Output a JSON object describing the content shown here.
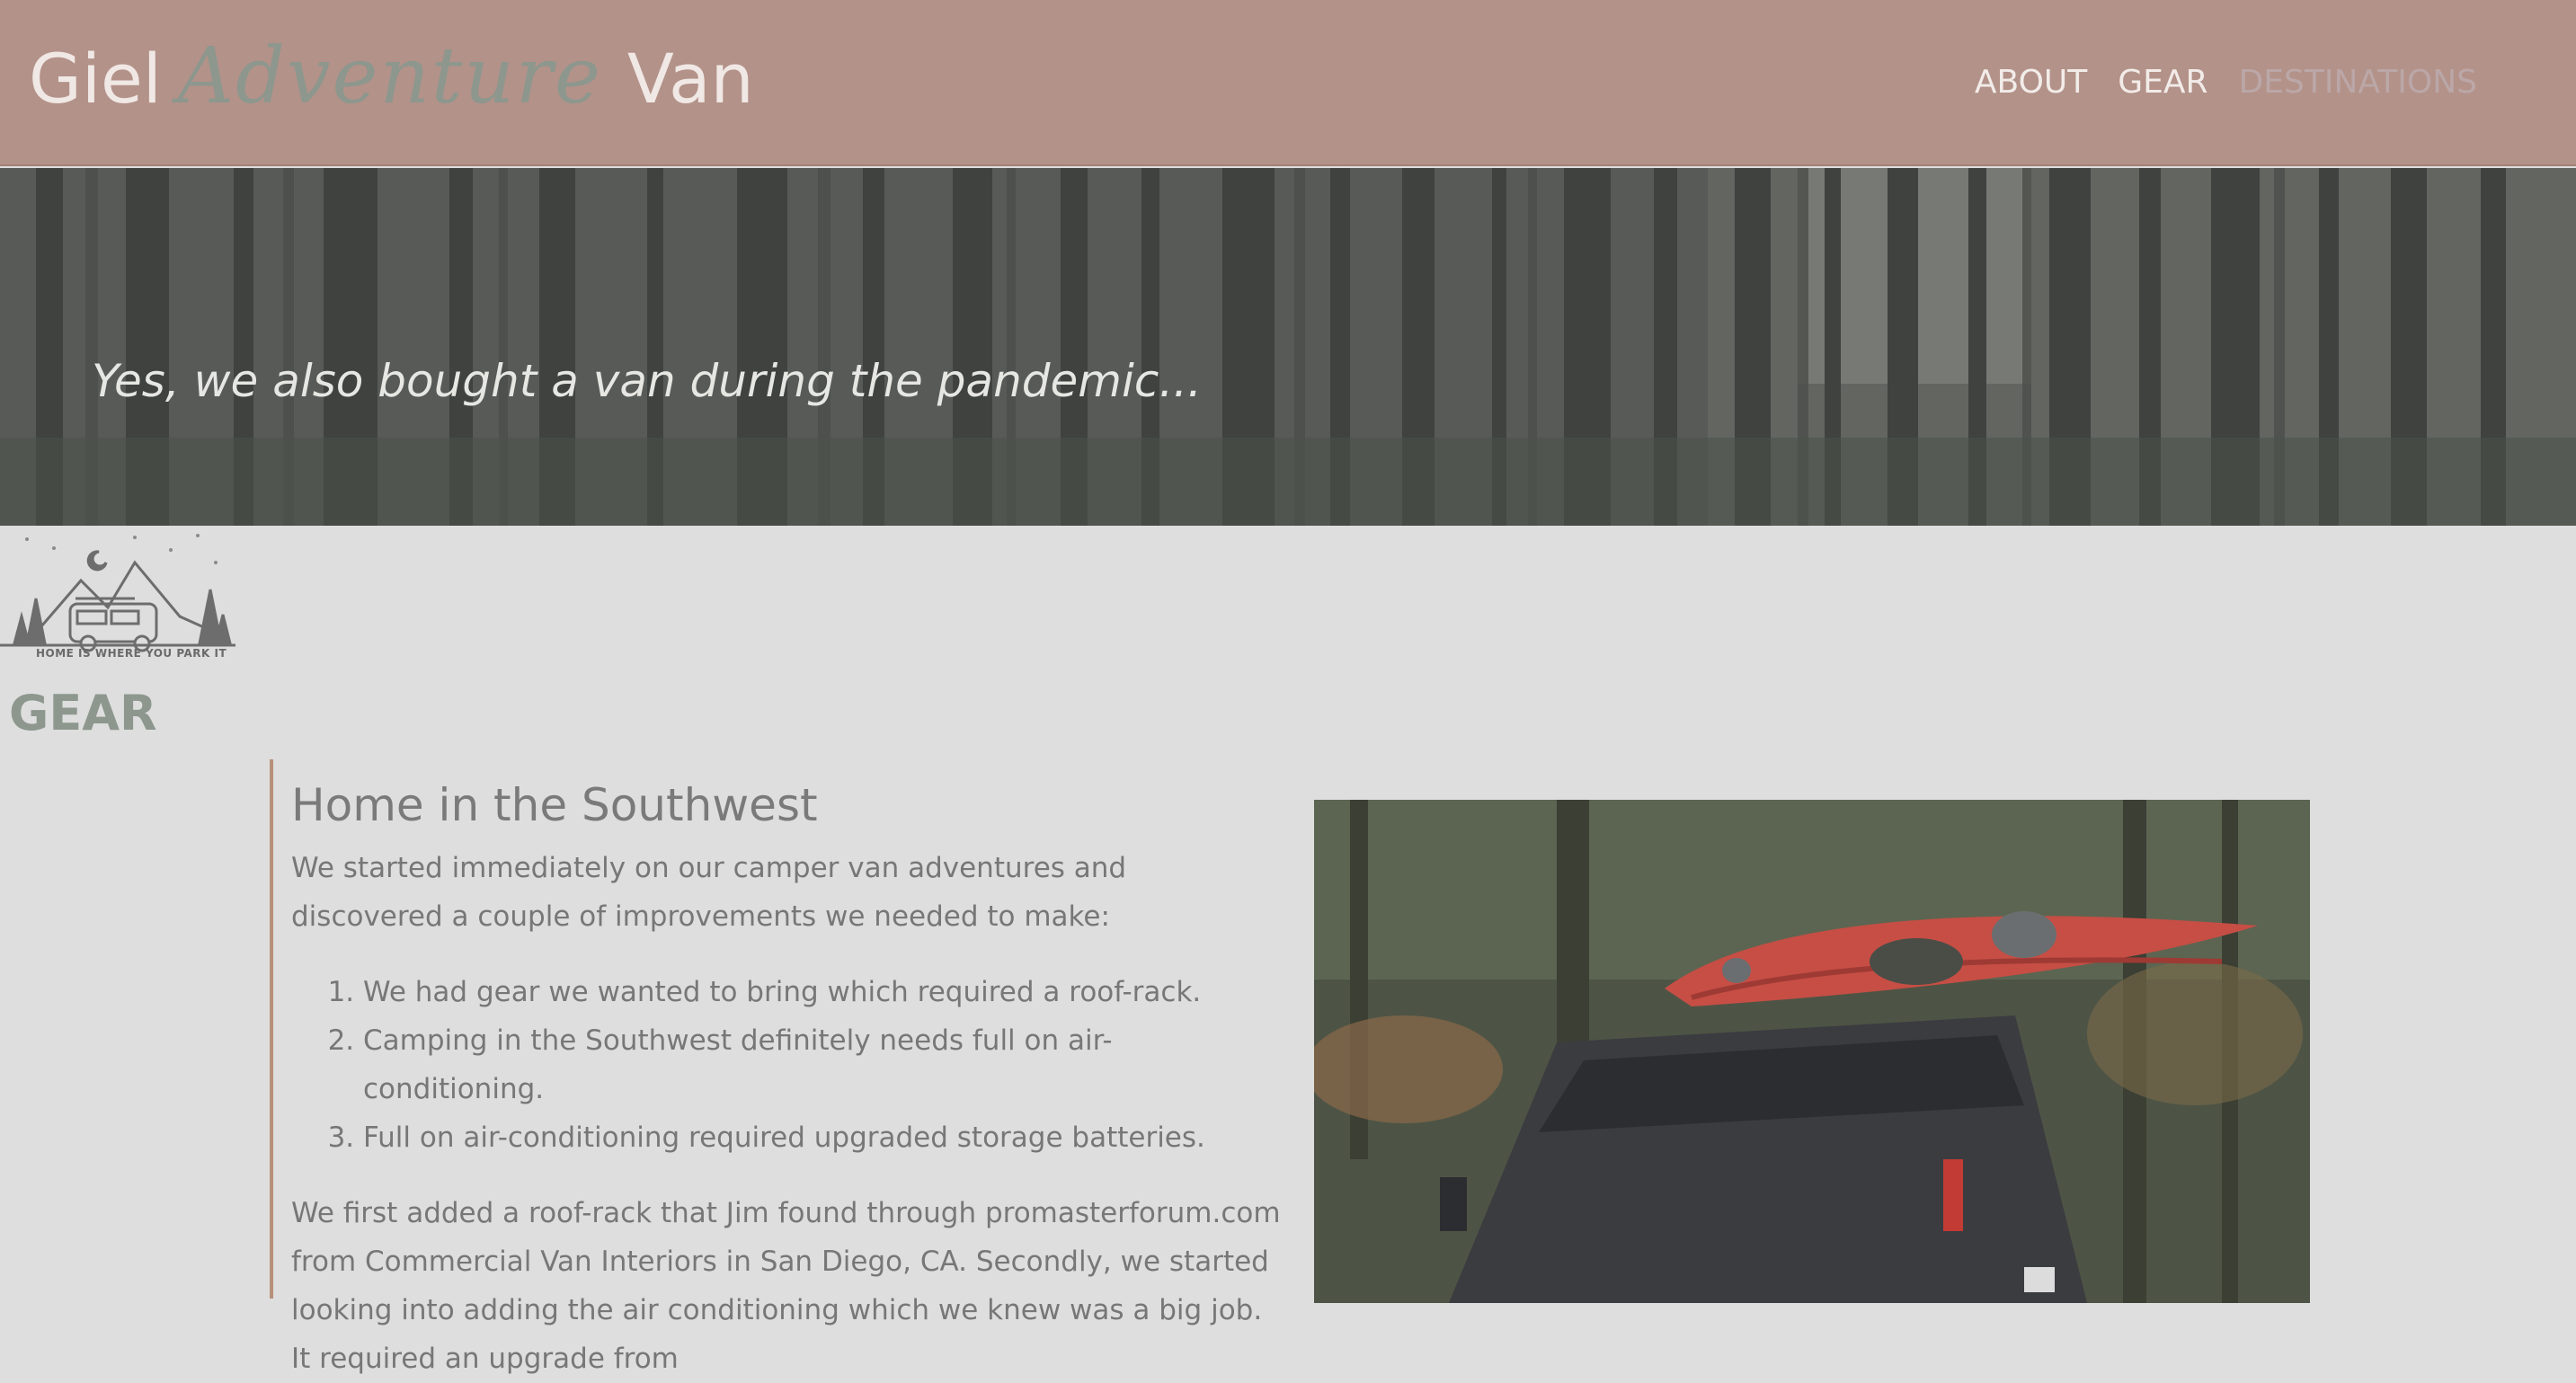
{
  "header": {
    "brand_first": "Giel",
    "brand_script": "Adventure",
    "brand_last": "Van",
    "nav": [
      {
        "label": "ABOUT"
      },
      {
        "label": "GEAR"
      },
      {
        "label": "DESTINATIONS"
      }
    ]
  },
  "hero": {
    "caption": "Yes, we also bought a van during the pandemic..."
  },
  "logo": {
    "text": "HOME IS WHERE YOU PARK IT",
    "icon": "van-mountain-logo-icon"
  },
  "section": {
    "title": "GEAR"
  },
  "article": {
    "heading": "Home in the Southwest",
    "intro": "We started immediately on our camper van adventures and discovered a couple of improvements we needed to make:",
    "list": [
      "We had gear we wanted to bring which required a roof-rack.",
      "Camping in the Southwest definitely needs full on air-conditioning.",
      "Full on air-conditioning required upgraded storage batteries."
    ],
    "body": "We first added a roof-rack that Jim found through promasterforum.com from Commercial Van Interiors in San Diego, CA. Secondly, we started looking into adding the air conditioning which we knew was a big job. It required an upgrade from"
  },
  "colors": {
    "header_bg": "#b39289",
    "accent_green": "#8d978e",
    "page_bg": "#dedede",
    "article_rule": "#b8907a"
  }
}
